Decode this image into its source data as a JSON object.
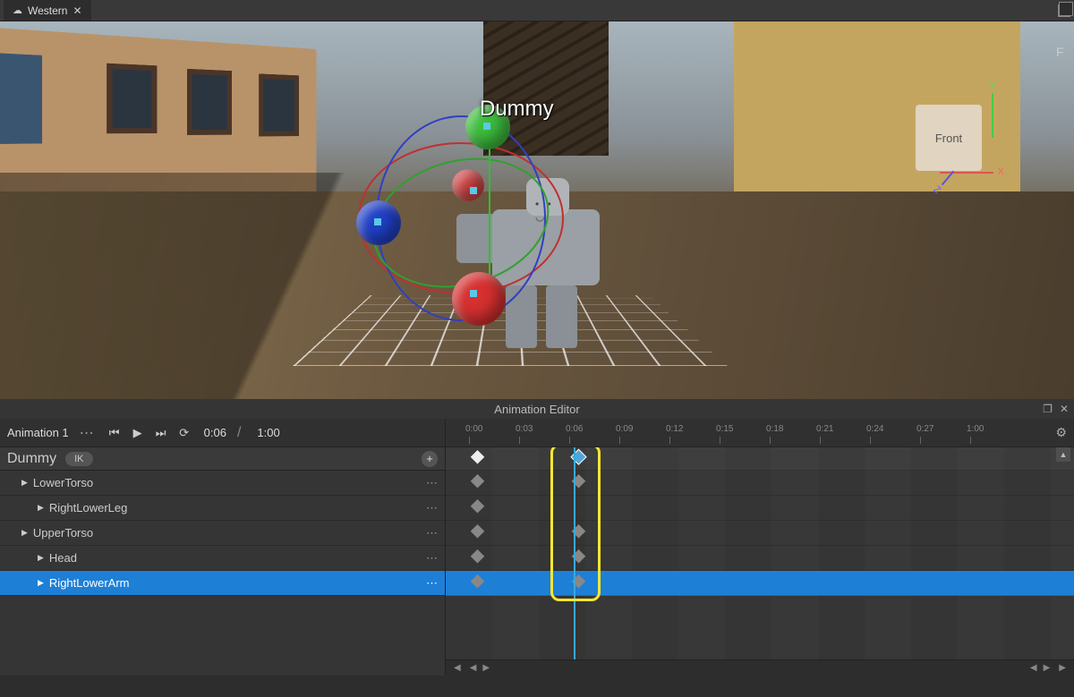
{
  "tab": {
    "title": "Western",
    "cloud_icon": "cloud-icon"
  },
  "viewport": {
    "character_label": "Dummy",
    "view_cube_face": "Front",
    "axis_labels": {
      "x": "X",
      "y": "Y",
      "z": "Z"
    }
  },
  "side_panel_letter": "F",
  "editor": {
    "title": "Animation Editor",
    "playback": {
      "animation_name": "Animation 1",
      "current_time": "0:06",
      "total_time": "1:00"
    },
    "model_name": "Dummy",
    "ik_label": "IK",
    "tracks": [
      {
        "name": "LowerTorso",
        "depth": 0,
        "selected": false,
        "expandable": true
      },
      {
        "name": "RightLowerLeg",
        "depth": 1,
        "selected": false,
        "expandable": true
      },
      {
        "name": "UpperTorso",
        "depth": 0,
        "selected": false,
        "expandable": true
      },
      {
        "name": "Head",
        "depth": 1,
        "selected": false,
        "expandable": true
      },
      {
        "name": "RightLowerArm",
        "depth": 1,
        "selected": true,
        "expandable": true
      }
    ],
    "ruler_ticks": [
      "0:00",
      "0:03",
      "0:06",
      "0:09",
      "0:12",
      "0:15",
      "0:18",
      "0:21",
      "0:24",
      "0:27",
      "1:00"
    ]
  }
}
